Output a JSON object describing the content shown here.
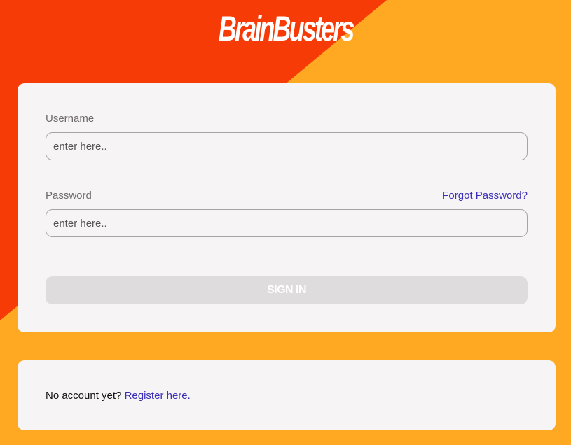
{
  "brand": {
    "logo_text": "BrainBusters"
  },
  "login": {
    "username_label": "Username",
    "username_placeholder": "enter here..",
    "password_label": "Password",
    "password_placeholder": "enter here..",
    "forgot_password_link": "Forgot Password?",
    "signin_button": "SIGN IN"
  },
  "register": {
    "prompt": "No account yet?",
    "link": "Register here."
  },
  "colors": {
    "background_orange": "#FFA923",
    "background_red": "#F73B06",
    "card": "#F7F4F5",
    "link": "#3a2fb8",
    "button_disabled": "#DEDCDD"
  }
}
